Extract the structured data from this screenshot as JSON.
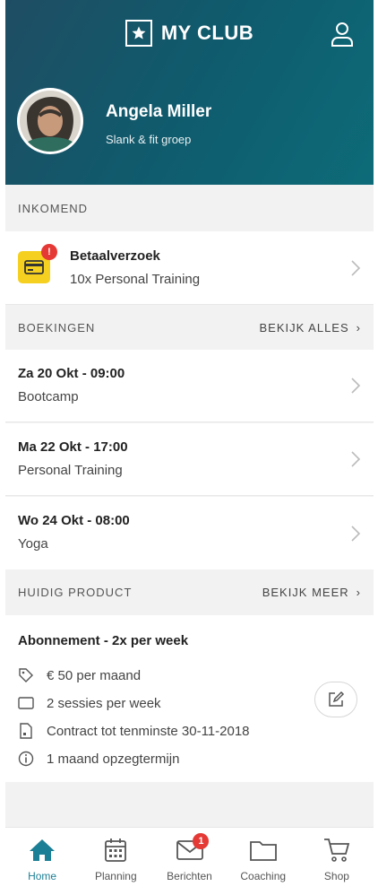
{
  "header": {
    "brand": "MY CLUB",
    "profile_name": "Angela Miller",
    "profile_group": "Slank & fit groep"
  },
  "incoming": {
    "section_label": "INKOMEND",
    "item": {
      "title": "Betaalverzoek",
      "subtitle": "10x Personal Training",
      "badge": "!"
    }
  },
  "bookings": {
    "section_label": "BOEKINGEN",
    "link_label": "BEKIJK ALLES",
    "items": [
      {
        "title": "Za 20 Okt - 09:00",
        "subtitle": "Bootcamp"
      },
      {
        "title": "Ma 22 Okt - 17:00",
        "subtitle": "Personal Training"
      },
      {
        "title": "Wo 24 Okt - 08:00",
        "subtitle": "Yoga"
      }
    ]
  },
  "product": {
    "section_label": "HUIDIG PRODUCT",
    "link_label": "BEKIJK MEER",
    "title": "Abonnement - 2x per week",
    "features": [
      {
        "icon": "price-tag-icon",
        "text": "€ 50 per maand"
      },
      {
        "icon": "ticket-icon",
        "text": "2 sessies per week"
      },
      {
        "icon": "contract-icon",
        "text": "Contract tot tenminste 30-11-2018"
      },
      {
        "icon": "info-icon",
        "text": "1 maand opzegtermijn"
      }
    ]
  },
  "nav": {
    "items": [
      {
        "label": "Home",
        "icon": "home-icon",
        "active": true
      },
      {
        "label": "Planning",
        "icon": "calendar-icon"
      },
      {
        "label": "Berichten",
        "icon": "mail-icon",
        "badge": "1"
      },
      {
        "label": "Coaching",
        "icon": "folder-icon"
      },
      {
        "label": "Shop",
        "icon": "cart-icon"
      }
    ]
  },
  "colors": {
    "header_gradient": [
      "#1f4d63",
      "#0d6b78"
    ],
    "accent": "#1b7f95",
    "badge": "#e53935",
    "payment_icon_bg": "#f5d020"
  }
}
